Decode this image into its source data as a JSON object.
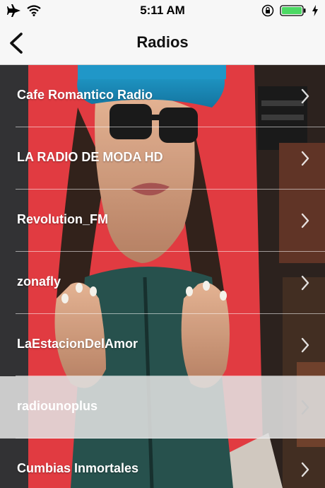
{
  "status_bar": {
    "time": "5:11 AM",
    "icons": [
      "airplane-icon",
      "wifi-icon",
      "orientation-lock-icon",
      "battery-icon",
      "charging-bolt-icon"
    ]
  },
  "nav": {
    "title": "Radios",
    "back_icon": "chevron-left-icon"
  },
  "radios": [
    {
      "label": "Cafe Romantico Radio"
    },
    {
      "label": "LA RADIO DE MODA HD"
    },
    {
      "label": "Revolution_FM"
    },
    {
      "label": "zonafly"
    },
    {
      "label": "LaEstacionDelAmor"
    },
    {
      "label": "radiounoplus",
      "selected": true
    },
    {
      "label": "Cumbias Inmortales"
    }
  ],
  "colors": {
    "bar_background": "#f7f7f7",
    "battery_green": "#4cd964",
    "row_text": "#ffffff",
    "selected_row": "#e1e1e1"
  }
}
